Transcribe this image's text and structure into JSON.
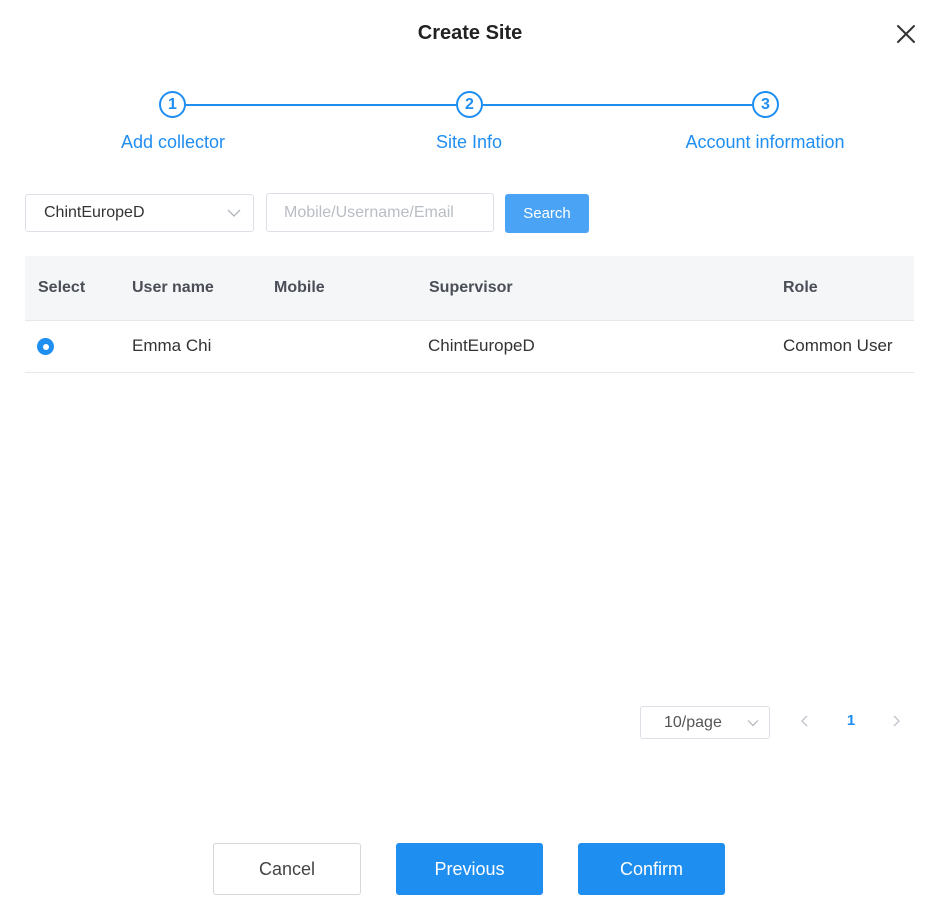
{
  "dialog": {
    "title": "Create Site"
  },
  "steps": [
    {
      "number": "1",
      "label": "Add collector"
    },
    {
      "number": "2",
      "label": "Site Info"
    },
    {
      "number": "3",
      "label": "Account information"
    }
  ],
  "filters": {
    "supervisor_select": "ChintEuropeD",
    "search_placeholder": "Mobile/Username/Email",
    "search_value": "",
    "search_label": "Search"
  },
  "table": {
    "columns": [
      "Select",
      "User name",
      "Mobile",
      "Supervisor",
      "Role"
    ],
    "rows": [
      {
        "selected": true,
        "username": "Emma Chi",
        "mobile": "",
        "supervisor": "ChintEuropeD",
        "role": "Common User"
      }
    ]
  },
  "pagination": {
    "page_size": "10/page",
    "current_page": "1"
  },
  "footer": {
    "cancel_label": "Cancel",
    "previous_label": "Previous",
    "confirm_label": "Confirm"
  },
  "colors": {
    "primary": "#1f8ef1",
    "search_button": "#4aa3f5",
    "header_bg": "#f5f6f8"
  }
}
